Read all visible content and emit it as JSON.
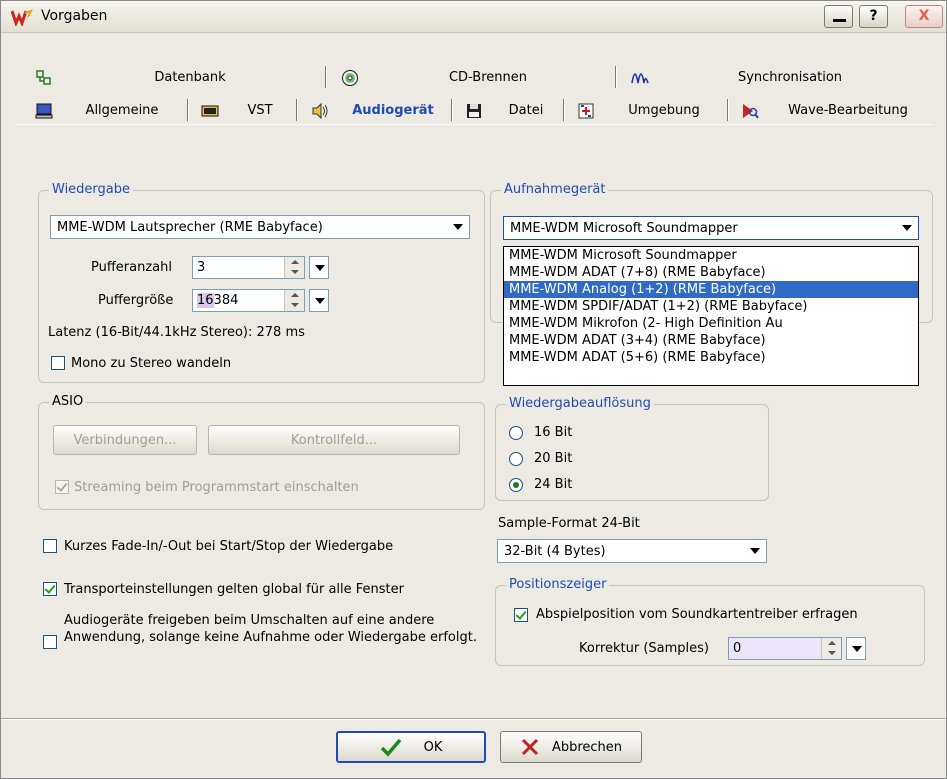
{
  "window": {
    "title": "Vorgaben",
    "btn_min": "_",
    "btn_help": "?",
    "btn_close": "X"
  },
  "tabs_row1": [
    {
      "label": "Datenbank",
      "icon": "database-icon"
    },
    {
      "label": "CD-Brennen",
      "icon": "cd-icon"
    },
    {
      "label": "Synchronisation",
      "icon": "sync-wave-icon"
    }
  ],
  "tabs_row2": [
    {
      "label": "Allgemeine",
      "icon": "computer-icon"
    },
    {
      "label": "VST",
      "icon": "vst-icon"
    },
    {
      "label": "Audiogerät",
      "icon": "speaker-icon",
      "active": true
    },
    {
      "label": "Datei",
      "icon": "floppy-icon"
    },
    {
      "label": "Umgebung",
      "icon": "environment-icon"
    },
    {
      "label": "Wave-Bearbeitung",
      "icon": "wave-edit-icon"
    }
  ],
  "wiedergabe": {
    "title": "Wiedergabe",
    "device": "MME-WDM Lautsprecher (RME Babyface)",
    "pufferanzahl_label": "Pufferanzahl",
    "pufferanzahl": "3",
    "puffergroesse_label": "Puffergröße",
    "puffergroesse_prefix": "16",
    "puffergroesse_rest": " 384",
    "latenz": "Latenz (16-Bit/44.1kHz Stereo): 278 ms",
    "mono": "Mono zu Stereo wandeln"
  },
  "asio": {
    "title": "ASIO",
    "verbindungen": "Verbindungen...",
    "kontrollfeld": "Kontrollfeld...",
    "streaming": "Streaming beim Programmstart einschalten"
  },
  "options": {
    "fade": "Kurzes Fade-In/-Out bei Start/Stop der Wiedergabe",
    "transport": "Transporteinstellungen gelten global für alle Fenster",
    "freigeben": "Audiogeräte freigeben beim Umschalten auf eine andere Anwendung, solange keine Aufnahme oder Wiedergabe erfolgt."
  },
  "aufnahme": {
    "title": "Aufnahmegerät",
    "selected": "MME-WDM Microsoft Soundmapper",
    "options": [
      "MME-WDM Microsoft Soundmapper",
      "MME-WDM ADAT (7+8) (RME Babyface)",
      "MME-WDM Analog (1+2) (RME Babyface)",
      "MME-WDM SPDIF/ADAT (1+2) (RME Babyface)",
      "MME-WDM Mikrofon (2- High Definition Au",
      "MME-WDM ADAT (3+4) (RME Babyface)",
      "MME-WDM ADAT (5+6) (RME Babyface)"
    ],
    "highlighted_index": 2
  },
  "aufloesung": {
    "title": "Wiedergabeauflösung",
    "bit16": "16 Bit",
    "bit20": "20 Bit",
    "bit24": "24 Bit",
    "selected": "24 Bit"
  },
  "sample_format": {
    "label": "Sample-Format 24-Bit",
    "value": "32-Bit (4 Bytes)"
  },
  "positionszeiger": {
    "title": "Positionszeiger",
    "abspiel": "Abspielposition vom Soundkartentreiber erfragen",
    "korrektur_label": "Korrektur (Samples)",
    "korrektur": "0"
  },
  "footer": {
    "ok": "OK",
    "cancel": "Abbrechen"
  },
  "colors": {
    "accent": "#1d4db3",
    "selection": "#316ac5",
    "face": "#eceae2"
  }
}
